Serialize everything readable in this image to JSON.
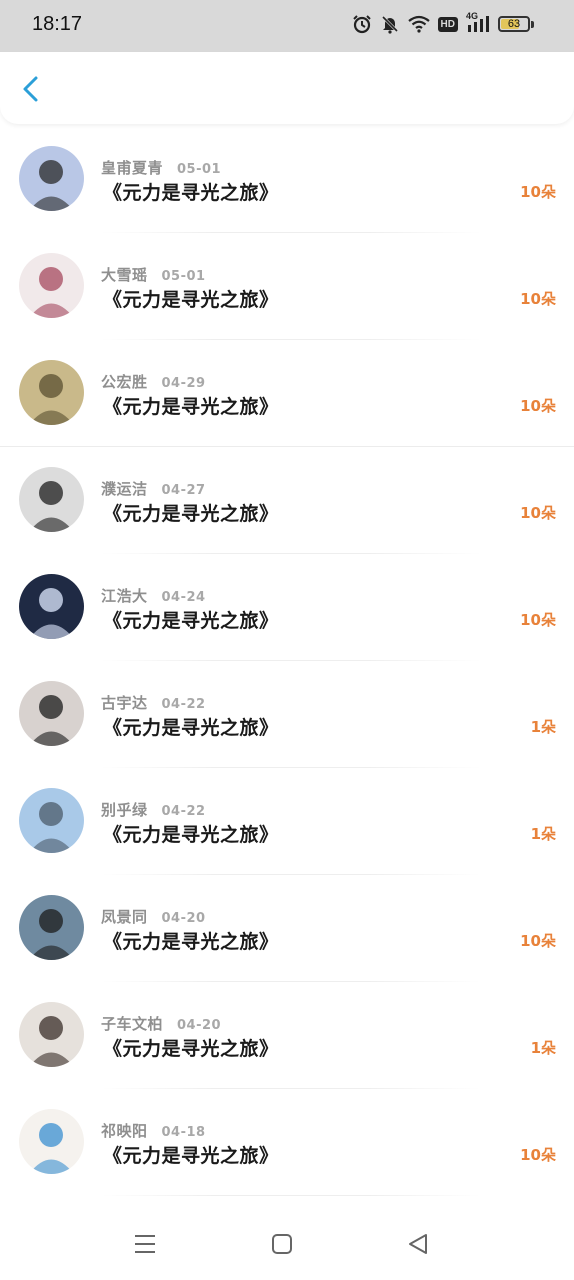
{
  "status": {
    "time": "18:17",
    "battery": "63",
    "network": "4G",
    "hd": "HD",
    "battery_fraction": 0.63
  },
  "colors": {
    "accent": "#2b9fd8",
    "amount": "#e8823a",
    "battery_fill": "#e2c55a"
  },
  "items": [
    {
      "name": "皇甫夏青",
      "date": "05-01",
      "title": "《元力是寻光之旅》",
      "amount": "10朵",
      "avatar": "avatar-child",
      "bg": "#b9c7e6",
      "fg": "#2a2a2a"
    },
    {
      "name": "大雪瑶",
      "date": "05-01",
      "title": "《元力是寻光之旅》",
      "amount": "10朵",
      "avatar": "avatar-couple",
      "bg": "#f1e9ea",
      "fg": "#a54a5f"
    },
    {
      "name": "公宏胜",
      "date": "04-29",
      "title": "《元力是寻光之旅》",
      "amount": "10朵",
      "avatar": "avatar-railway",
      "bg": "#c9b98a",
      "fg": "#5a5030"
    },
    {
      "name": "濮运洁",
      "date": "04-27",
      "title": "《元力是寻光之旅》",
      "amount": "10朵",
      "avatar": "avatar-sunglasses-girl",
      "bg": "#dcdcdc",
      "fg": "#1e1e1e"
    },
    {
      "name": "江浩大",
      "date": "04-24",
      "title": "《元力是寻光之旅》",
      "amount": "10朵",
      "avatar": "avatar-night-light",
      "bg": "#1f2a44",
      "fg": "#dfe9ff"
    },
    {
      "name": "古宇达",
      "date": "04-22",
      "title": "《元力是寻光之旅》",
      "amount": "1朵",
      "avatar": "avatar-girl-portrait",
      "bg": "#d8d2cf",
      "fg": "#1b1b1b"
    },
    {
      "name": "别乎绿",
      "date": "04-22",
      "title": "《元力是寻光之旅》",
      "amount": "1朵",
      "avatar": "avatar-seaside",
      "bg": "#a9c9e8",
      "fg": "#4c5b6b"
    },
    {
      "name": "凤景同",
      "date": "04-20",
      "title": "《元力是寻光之旅》",
      "amount": "10朵",
      "avatar": "avatar-sunset-girl",
      "bg": "#6f8aa0",
      "fg": "#1c1c1c"
    },
    {
      "name": "子车文柏",
      "date": "04-20",
      "title": "《元力是寻光之旅》",
      "amount": "1朵",
      "avatar": "avatar-boy",
      "bg": "#e6e1dc",
      "fg": "#3a2e2a"
    },
    {
      "name": "祁映阳",
      "date": "04-18",
      "title": "《元力是寻光之旅》",
      "amount": "10朵",
      "avatar": "avatar-cartoon",
      "bg": "#f5f2ee",
      "fg": "#3a8fd0"
    }
  ]
}
